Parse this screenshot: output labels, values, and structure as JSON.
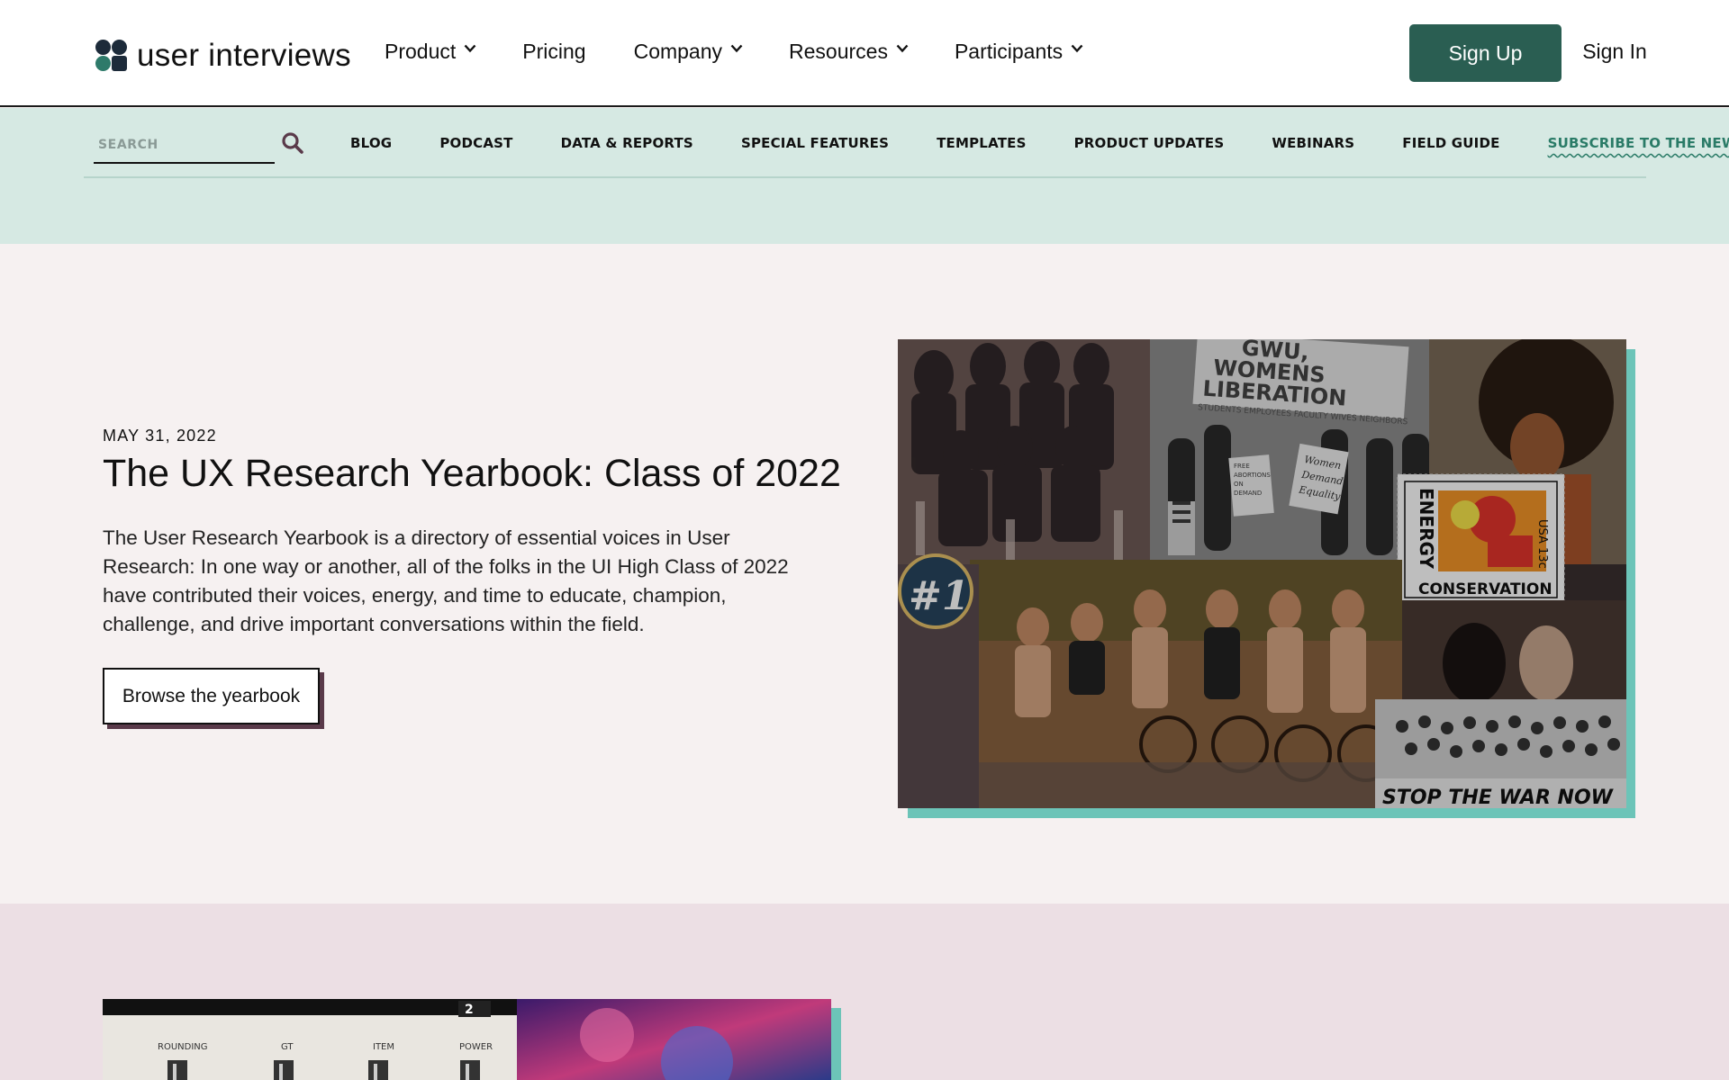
{
  "header": {
    "logo_text": "user interviews",
    "nav": [
      {
        "label": "Product",
        "has_dropdown": true
      },
      {
        "label": "Pricing",
        "has_dropdown": false
      },
      {
        "label": "Company",
        "has_dropdown": true
      },
      {
        "label": "Resources",
        "has_dropdown": true
      },
      {
        "label": "Participants",
        "has_dropdown": true
      }
    ],
    "signup_label": "Sign Up",
    "signin_label": "Sign In"
  },
  "subnav": {
    "search_placeholder": "SEARCH",
    "items": [
      "BLOG",
      "PODCAST",
      "DATA & REPORTS",
      "SPECIAL FEATURES",
      "TEMPLATES",
      "PRODUCT UPDATES",
      "WEBINARS",
      "FIELD GUIDE",
      "SUBSCRIBE TO THE NEWSLETTER"
    ]
  },
  "hero": {
    "date": "MAY 31, 2022",
    "title": "The UX Research Yearbook: Class of 2022",
    "description": "The User Research Yearbook is a directory of essential voices in User Research: In one way or another, all of the folks in the UI High Class of 2022 have contributed their voices, energy, and time to educate, champion, challenge, and drive important conversations within the field.",
    "cta_label": "Browse the yearbook",
    "image": {
      "banner_text": [
        "GWU,",
        "WOMENS",
        "LIBERATION"
      ],
      "banner_subtext": "STUDENTS EMPLOYEES FACULTY WIVES NEIGHBORS",
      "sign_text": [
        "Women",
        "Demand",
        "Equality"
      ],
      "sign2_text": [
        "FREE",
        "ABORTIONS",
        "ON",
        "DEMAND"
      ],
      "badge_text": "#1",
      "stamp_vertical": "ENERGY",
      "stamp_bottom": "CONSERVATION",
      "stamp_value": "USA 13c",
      "bottom_banner": "STOP THE WAR NOW"
    }
  },
  "next_section": {
    "image": {
      "labels": [
        "ROUNDING",
        "GT",
        "ITEM",
        "POWER"
      ],
      "badge": "2"
    }
  },
  "colors": {
    "brand_green": "#2a5e52",
    "accent_teal": "#2a7b67",
    "subnav_bg": "#d6e9e3",
    "hero_bg": "#f6f1f1",
    "next_bg": "#ecdfe4"
  }
}
